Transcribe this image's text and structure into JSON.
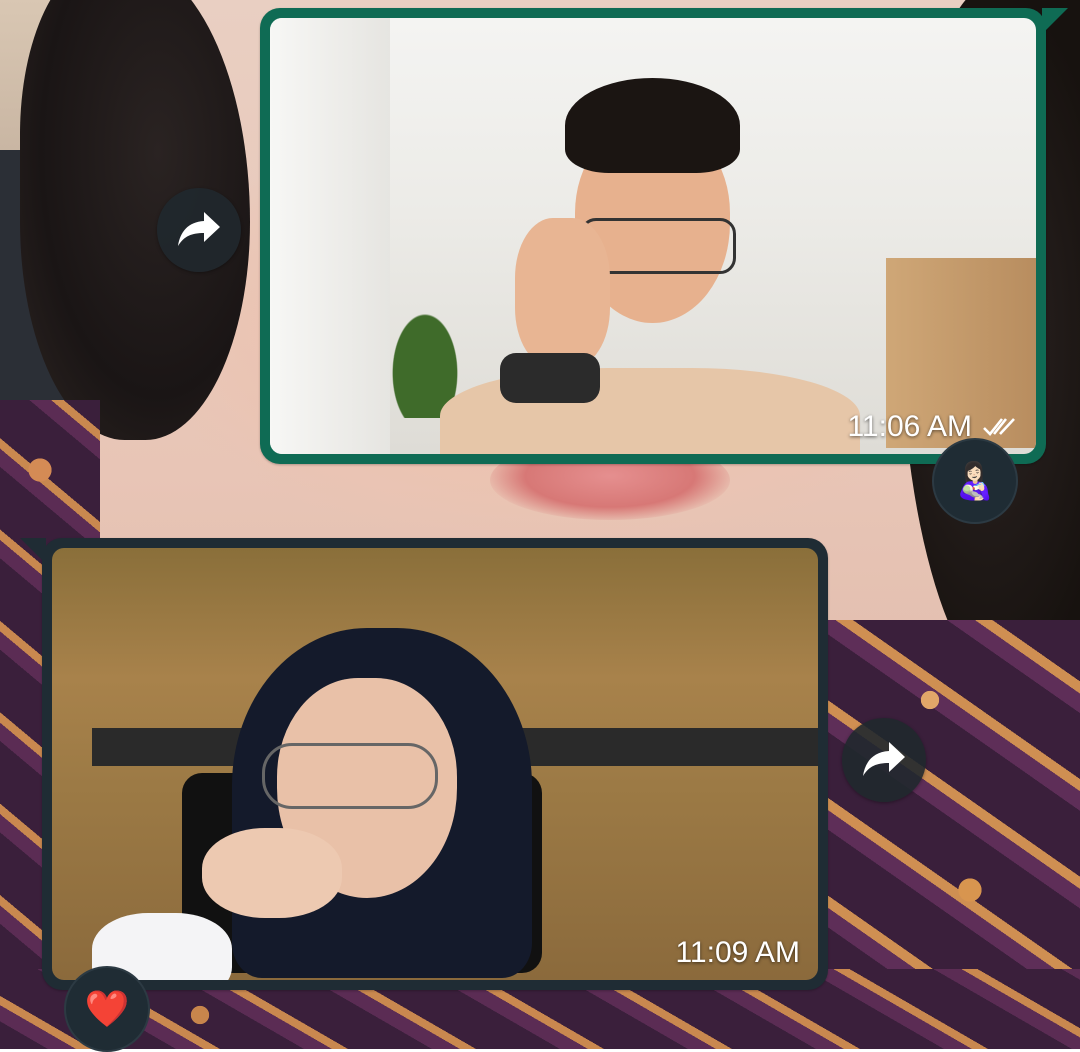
{
  "messages": [
    {
      "direction": "outgoing",
      "time": "11:06 AM",
      "status": "read",
      "status_icon": "double-check-icon",
      "reaction": "👩🏻‍🍼",
      "forward_icon": "forward-icon"
    },
    {
      "direction": "incoming",
      "time": "11:09 AM",
      "reaction": "❤️",
      "forward_icon": "forward-icon"
    }
  ],
  "colors": {
    "outgoing_bubble": "#0f6b54",
    "incoming_bubble": "#1f2c34",
    "control_bg": "#20282e"
  }
}
